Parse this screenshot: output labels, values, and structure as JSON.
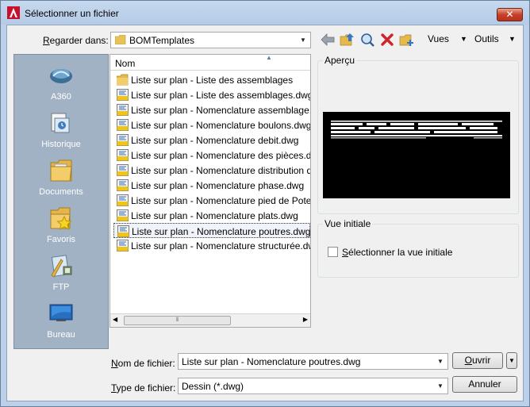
{
  "window": {
    "title": "Sélectionner un fichier",
    "close_label": "✕"
  },
  "lookin": {
    "label_prefix": "R",
    "label_rest": "egarder dans:",
    "value": "BOMTemplates"
  },
  "toolbar": {
    "views_label": "Vues",
    "tools_label": "Outils",
    "icons": [
      "back-icon",
      "up-folder-icon",
      "search-web-icon",
      "delete-icon",
      "new-folder-icon"
    ]
  },
  "places": [
    {
      "label": "A360",
      "icon": "a360-icon"
    },
    {
      "label": "Historique",
      "icon": "history-icon"
    },
    {
      "label": "Documents",
      "icon": "documents-icon"
    },
    {
      "label": "Favoris",
      "icon": "favorites-icon"
    },
    {
      "label": "FTP",
      "icon": "ftp-icon"
    },
    {
      "label": "Bureau",
      "icon": "desktop-icon"
    }
  ],
  "filelist": {
    "column_header": "Nom",
    "items": [
      {
        "name": "Liste sur plan - Liste des assemblages",
        "type": "folder"
      },
      {
        "name": "Liste sur plan - Liste des assemblages.dwg",
        "type": "dwg"
      },
      {
        "name": "Liste sur plan - Nomenclature assemblage.dwg",
        "type": "dwg"
      },
      {
        "name": "Liste sur plan - Nomenclature boulons.dwg",
        "type": "dwg"
      },
      {
        "name": "Liste sur plan - Nomenclature debit.dwg",
        "type": "dwg"
      },
      {
        "name": "Liste sur plan - Nomenclature des pièces.dwg",
        "type": "dwg"
      },
      {
        "name": "Liste sur plan - Nomenclature distribution des profils.dwg",
        "type": "dwg"
      },
      {
        "name": "Liste sur plan - Nomenclature phase.dwg",
        "type": "dwg"
      },
      {
        "name": "Liste sur plan - Nomenclature pied de Poteaux.dwg",
        "type": "dwg"
      },
      {
        "name": "Liste sur plan - Nomenclature plats.dwg",
        "type": "dwg"
      },
      {
        "name": "Liste sur plan - Nomenclature poutres.dwg",
        "type": "dwg",
        "selected": true
      },
      {
        "name": "Liste sur plan - Nomenclature structurée.dwg",
        "type": "dwg"
      }
    ]
  },
  "preview": {
    "title": "Aperçu"
  },
  "initial_view": {
    "title": "Vue initiale",
    "checkbox_label_prefix": "S",
    "checkbox_label_rest": "électionner la vue initiale",
    "checked": false
  },
  "filename": {
    "label_prefix": "N",
    "label_rest": "om de fichier:",
    "value": "Liste sur plan - Nomenclature poutres.dwg"
  },
  "filetype": {
    "label_prefix": "T",
    "label_rest": "ype de fichier:",
    "value": "Dessin (*.dwg)"
  },
  "buttons": {
    "open_prefix": "O",
    "open_rest": "uvrir",
    "cancel": "Annuler"
  }
}
